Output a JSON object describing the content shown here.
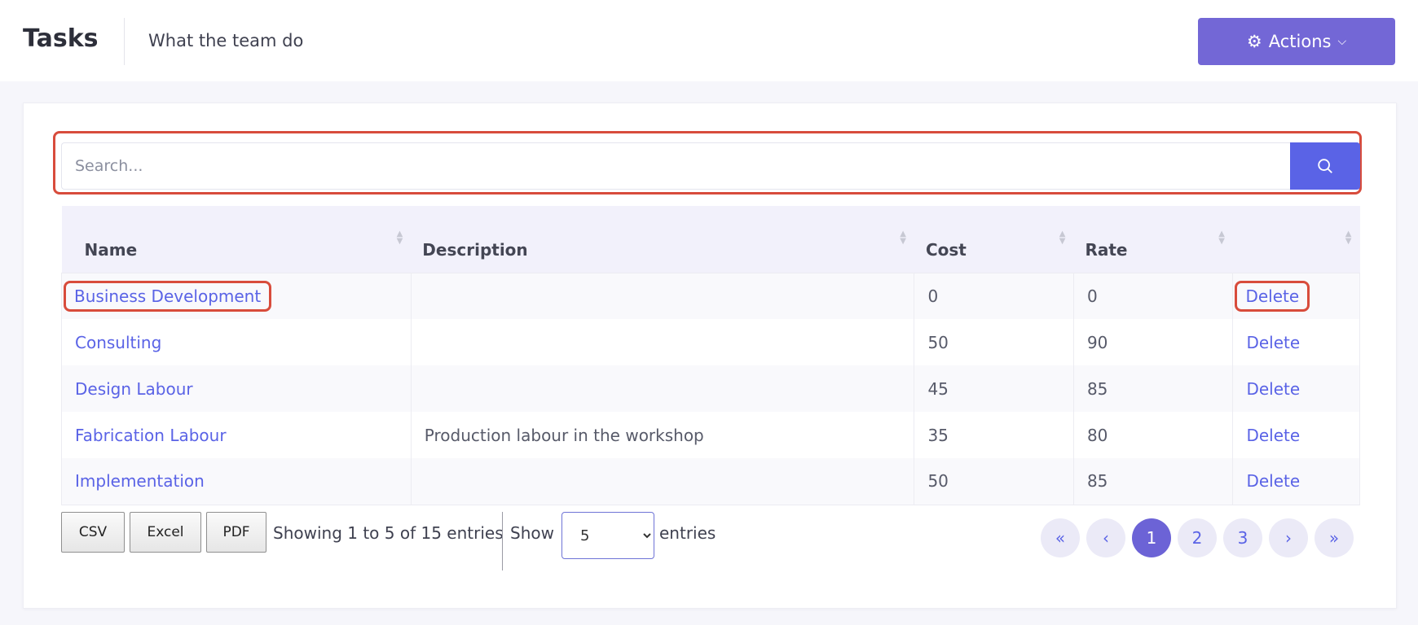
{
  "header": {
    "title": "Tasks",
    "subtitle": "What the team do",
    "actions_label": "Actions"
  },
  "search": {
    "placeholder": "Search..."
  },
  "table": {
    "columns": [
      "Name",
      "Description",
      "Cost",
      "Rate",
      ""
    ],
    "rows": [
      {
        "name": "Business Development",
        "description": "",
        "cost": "0",
        "rate": "0",
        "action": "Delete"
      },
      {
        "name": "Consulting",
        "description": "",
        "cost": "50",
        "rate": "90",
        "action": "Delete"
      },
      {
        "name": "Design Labour",
        "description": "",
        "cost": "45",
        "rate": "85",
        "action": "Delete"
      },
      {
        "name": "Fabrication Labour",
        "description": "Production labour in the workshop",
        "cost": "35",
        "rate": "80",
        "action": "Delete"
      },
      {
        "name": "Implementation",
        "description": "",
        "cost": "50",
        "rate": "85",
        "action": "Delete"
      }
    ]
  },
  "footer": {
    "export_buttons": [
      "CSV",
      "Excel",
      "PDF"
    ],
    "showing_text": "Showing 1 to 5 of 15 entries",
    "show_label": "Show",
    "page_size": "5",
    "entries_label": "entries"
  },
  "pagination": {
    "first": "«",
    "prev": "‹",
    "pages": [
      "1",
      "2",
      "3"
    ],
    "current": "1",
    "next": "›",
    "last": "»"
  },
  "colors": {
    "accent": "#5a63e6",
    "actions_button": "#7367d6",
    "highlight": "#d84c3c"
  },
  "icons": {
    "actions": "gear-icon",
    "actions_caret": "chevron-down-icon",
    "search": "search-icon",
    "sort": "sort-icon"
  }
}
